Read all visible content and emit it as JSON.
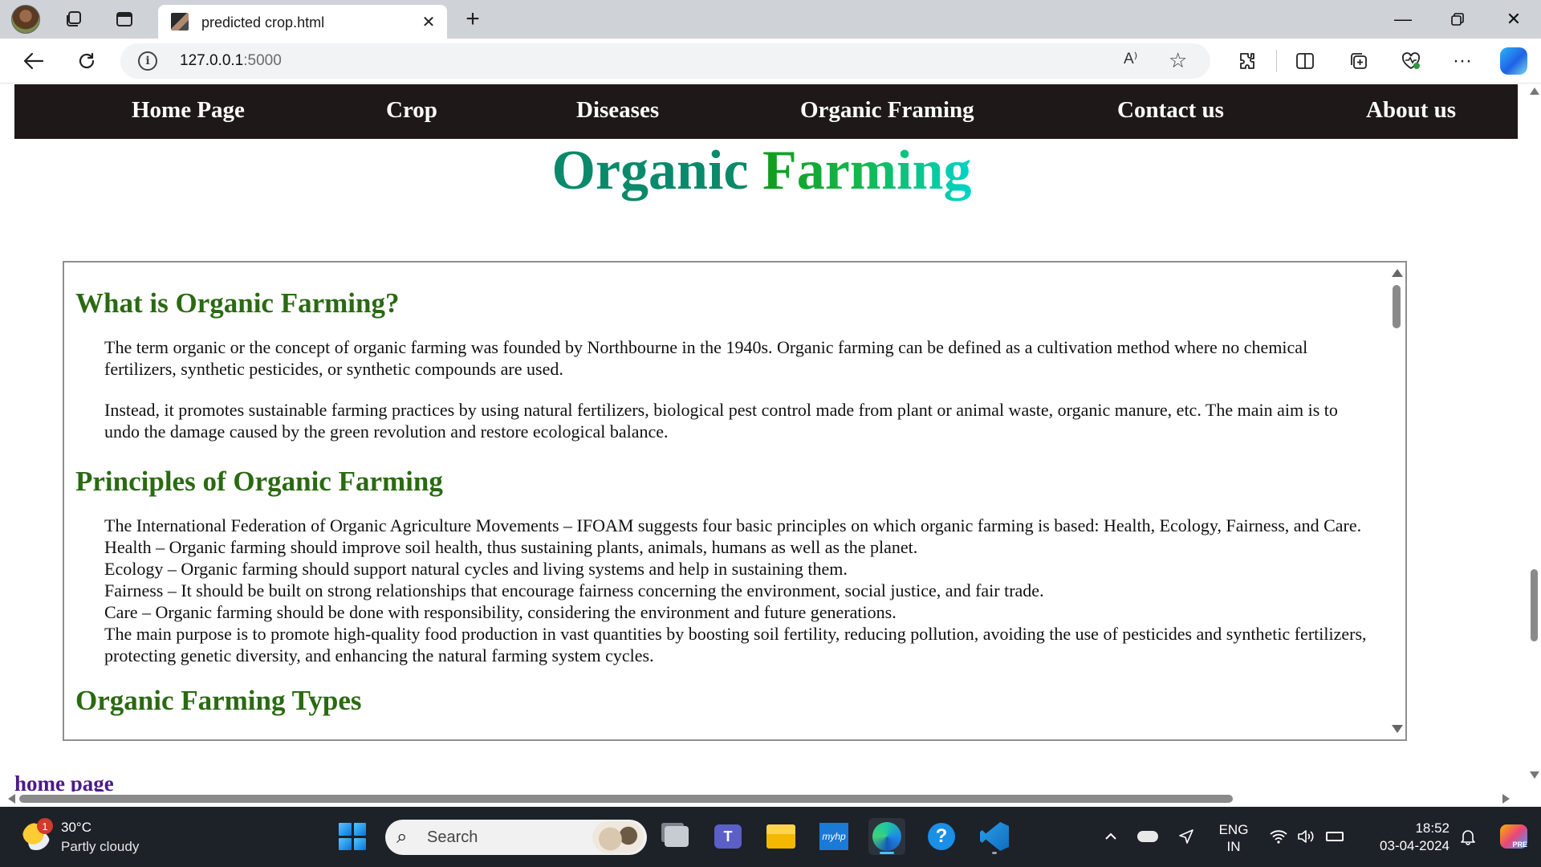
{
  "browser": {
    "tab_title": "predicted crop.html",
    "url_host": "127.0.0.1",
    "url_port": ":5000",
    "read_aloud_label": "A⁾",
    "icons": [
      "profile-avatar",
      "workspaces-icon",
      "tab-actions-icon",
      "close-tab-icon",
      "new-tab-icon",
      "minimize-icon",
      "restore-icon",
      "window-close-icon",
      "back-icon",
      "reload-icon",
      "site-info-icon",
      "read-aloud-icon",
      "favorite-star-icon",
      "extensions-icon",
      "split-screen-icon",
      "collections-icon",
      "browser-essentials-icon",
      "more-icon",
      "copilot-icon"
    ]
  },
  "site": {
    "nav": [
      "Home Page",
      "Crop",
      "Diseases",
      "Organic Framing",
      "Contact us",
      "About us"
    ],
    "heading_word1": "Organic",
    "heading_word2": "Farming",
    "sections": {
      "what_title": "What is Organic Farming?",
      "what_p1": "The term organic or the concept of organic farming was founded by Northbourne in the 1940s. Organic farming can be defined as a cultivation method where no chemical fertilizers, synthetic pesticides, or synthetic compounds are used.",
      "what_p2": "Instead, it promotes sustainable farming practices by using natural fertilizers, biological pest control made from plant or animal waste, organic manure, etc. The main aim is to undo the damage caused by the green revolution and restore ecological balance.",
      "principles_title": "Principles of Organic Farming",
      "principles_lines": [
        "The International Federation of Organic Agriculture Movements – IFOAM suggests four basic principles on which organic farming is based: Health, Ecology, Fairness, and Care.",
        "Health – Organic farming should improve soil health, thus sustaining plants, animals, humans as well as the planet.",
        "Ecology – Organic farming should support natural cycles and living systems and help in sustaining them.",
        "Fairness – It should be built on strong relationships that encourage fairness concerning the environment, social justice, and fair trade.",
        "Care – Organic farming should be done with responsibility, considering the environment and future generations.",
        "The main purpose is to promote high-quality food production in vast quantities by boosting soil fertility, reducing pollution, avoiding the use of pesticides and synthetic fertilizers, protecting genetic diversity, and enhancing the natural farming system cycles."
      ],
      "types_title_partial": "Organic Farming Types"
    },
    "home_link": "home page"
  },
  "taskbar": {
    "weather_badge": "1",
    "weather_temp": "30°C",
    "weather_cond": "Partly cloudy",
    "search_placeholder": "Search",
    "myhp_label": "myhp",
    "help_label": "?",
    "teams_label": "T",
    "lang_top": "ENG",
    "lang_bottom": "IN",
    "time": "18:52",
    "date": "03-04-2024",
    "copilot_badge": "PRE",
    "colors": {
      "taskbar": "#1d2128",
      "nav": "#1f1818",
      "heading_green": "#2a6a12",
      "link": "#4b1b8a"
    }
  }
}
